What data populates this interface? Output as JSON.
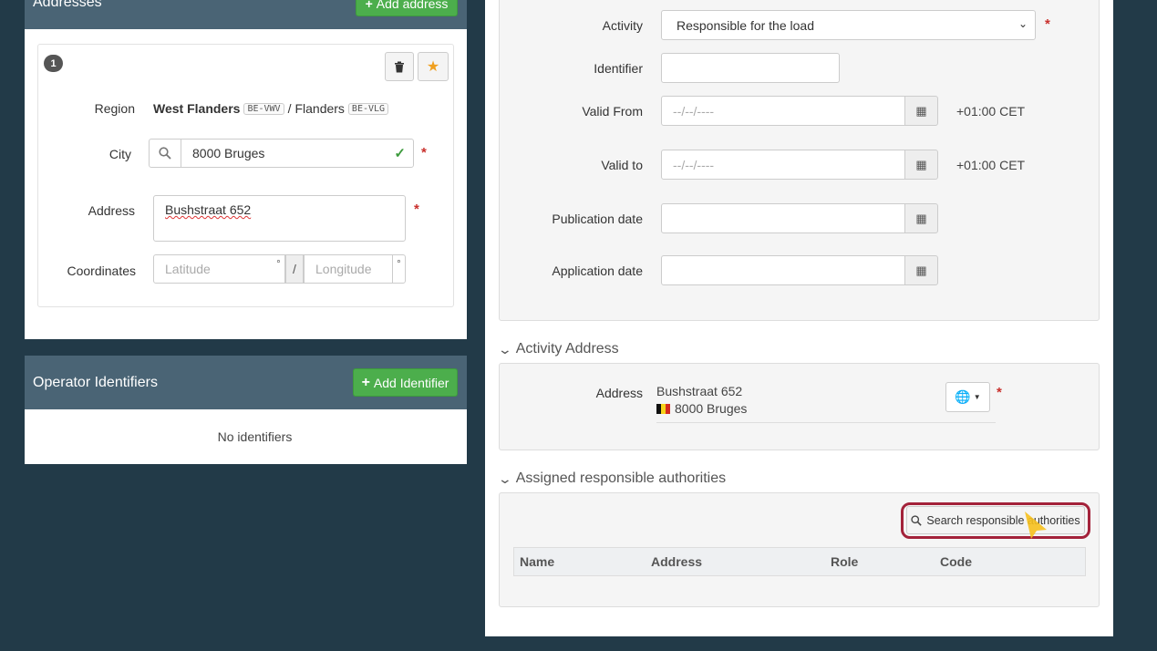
{
  "addresses": {
    "title": "Addresses",
    "add_label": "Add address",
    "index_badge": "1",
    "region_label": "Region",
    "region_value": "West Flanders",
    "region_code": "BE-VWV",
    "region_separator": "/",
    "region_parent": "Flanders",
    "region_parent_code": "BE-VLG",
    "city_label": "City",
    "city_value": "8000 Bruges",
    "address_label": "Address",
    "address_value": "Bushstraat 652",
    "coordinates_label": "Coordinates",
    "latitude_placeholder": "Latitude",
    "longitude_placeholder": "Longitude",
    "degree": "°",
    "slash": "/"
  },
  "operator_identifiers": {
    "title": "Operator Identifiers",
    "add_label": "Add Identifier",
    "empty_text": "No identifiers"
  },
  "form": {
    "activity_label": "Activity",
    "activity_value": "Responsible for the load",
    "identifier_label": "Identifier",
    "valid_from_label": "Valid From",
    "valid_from_placeholder": "--/--/----",
    "valid_to_label": "Valid to",
    "valid_to_placeholder": "--/--/----",
    "timezone": "+01:00 CET",
    "publication_label": "Publication date",
    "application_label": "Application date"
  },
  "activity_address": {
    "title": "Activity Address",
    "address_label": "Address",
    "street": "Bushstraat 652",
    "city": "8000 Bruges"
  },
  "authorities": {
    "title": "Assigned responsible authorities",
    "search_label": "Search responsible authorities",
    "columns": [
      "Name",
      "Address",
      "Role",
      "Code"
    ]
  },
  "required_mark": "*",
  "colors": {
    "background": "#223a48",
    "panel_header": "#4a6475",
    "success": "#4cae4c",
    "highlight_ring": "#a3223a",
    "star": "#f0a020"
  }
}
